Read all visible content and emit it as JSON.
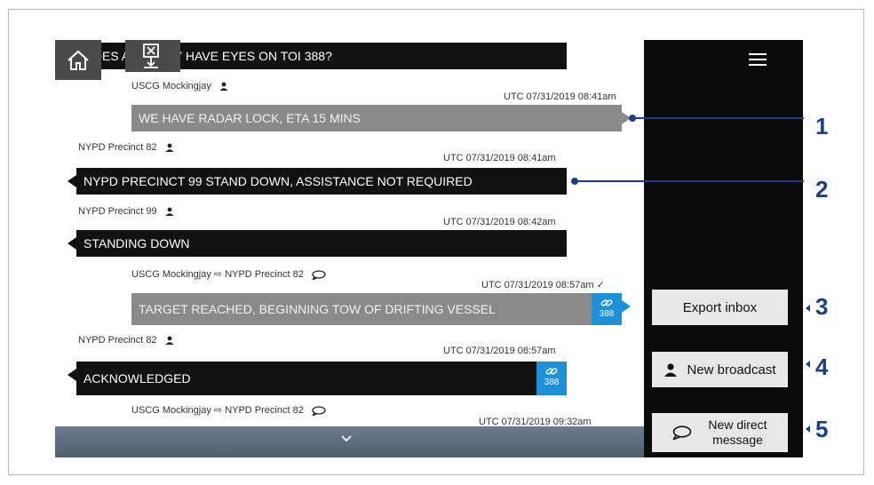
{
  "messages": [
    {
      "text": "DOES ANYBODY HAVE EYES ON TOI 388?"
    },
    {
      "sender": "USCG Mockingjay",
      "time": "UTC 07/31/2019 08:41am",
      "text": "WE HAVE RADAR LOCK, ETA 15 MINS"
    },
    {
      "sender": "NYPD Precinct 82",
      "time": "UTC 07/31/2019 08:41am",
      "text": "NYPD PRECINCT 99 STAND DOWN, ASSISTANCE NOT REQUIRED"
    },
    {
      "sender": "NYPD Precinct 99",
      "time": "UTC 07/31/2019 08:42am",
      "text": "STANDING DOWN"
    },
    {
      "sender": "USCG Mockingjay ⇨ NYPD Precinct 82",
      "time": "UTC 07/31/2019 08:57am ✓",
      "text": "TARGET REACHED, BEGINNING TOW OF DRIFTING VESSEL",
      "link": "388"
    },
    {
      "sender": "NYPD Precinct 82",
      "time": "UTC 07/31/2019 08:57am",
      "text": "ACKNOWLEDGED",
      "link": "388"
    },
    {
      "sender": "USCG Mockingjay ⇨ NYPD Precinct 82",
      "time": "UTC 07/31/2019 09:32am"
    }
  ],
  "sidebar": {
    "export_label": "Export inbox",
    "broadcast_label": "New broadcast",
    "direct_label_1": "New direct",
    "direct_label_2": "message"
  },
  "callouts": [
    "1",
    "2",
    "3",
    "4",
    "5"
  ],
  "colors": {
    "accent": "#1e90d8",
    "callout": "#1a3f8a",
    "sidebar": "#0b0b0b"
  },
  "icons": [
    "home-icon",
    "export-icon",
    "menu-icon",
    "user-icon",
    "chat-bubble-icon",
    "link-icon",
    "chevron-down-icon"
  ]
}
